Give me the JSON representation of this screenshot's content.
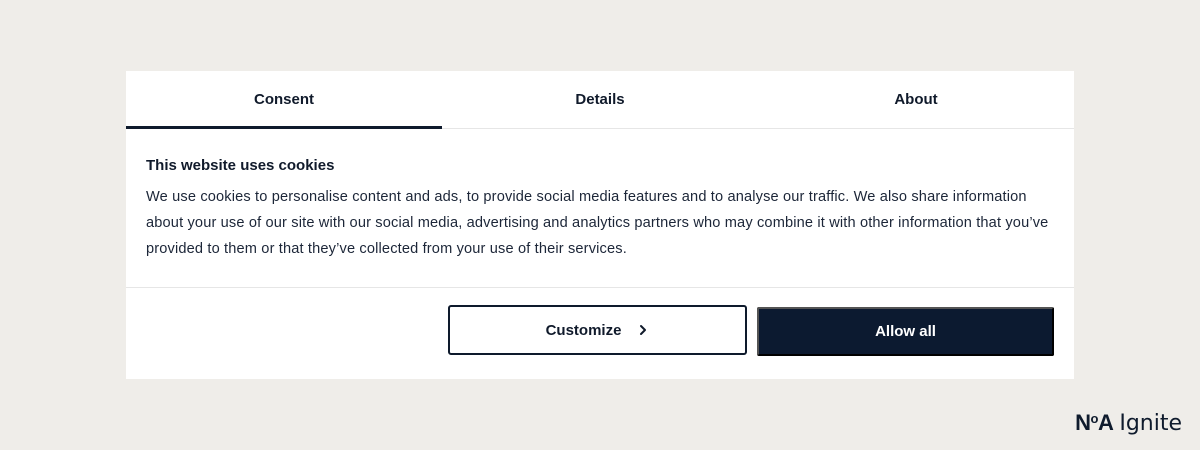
{
  "tabs": [
    {
      "label": "Consent",
      "active": true
    },
    {
      "label": "Details",
      "active": false
    },
    {
      "label": "About",
      "active": false
    }
  ],
  "content": {
    "heading": "This website uses cookies",
    "body": "We use cookies to personalise content and ads, to provide social media features and to analyse our traffic. We also share information about your use of our site with our social media, advertising and analytics partners who may combine it with other information that you’ve provided to them or that they’ve collected from your use of their services."
  },
  "actions": {
    "customize_label": "Customize",
    "allow_all_label": "Allow all"
  },
  "brand": {
    "noa": "NoA",
    "ignite": "Ignite"
  },
  "colors": {
    "page_bg": "#efede9",
    "dialog_bg": "#ffffff",
    "accent_dark": "#0c1a30"
  }
}
